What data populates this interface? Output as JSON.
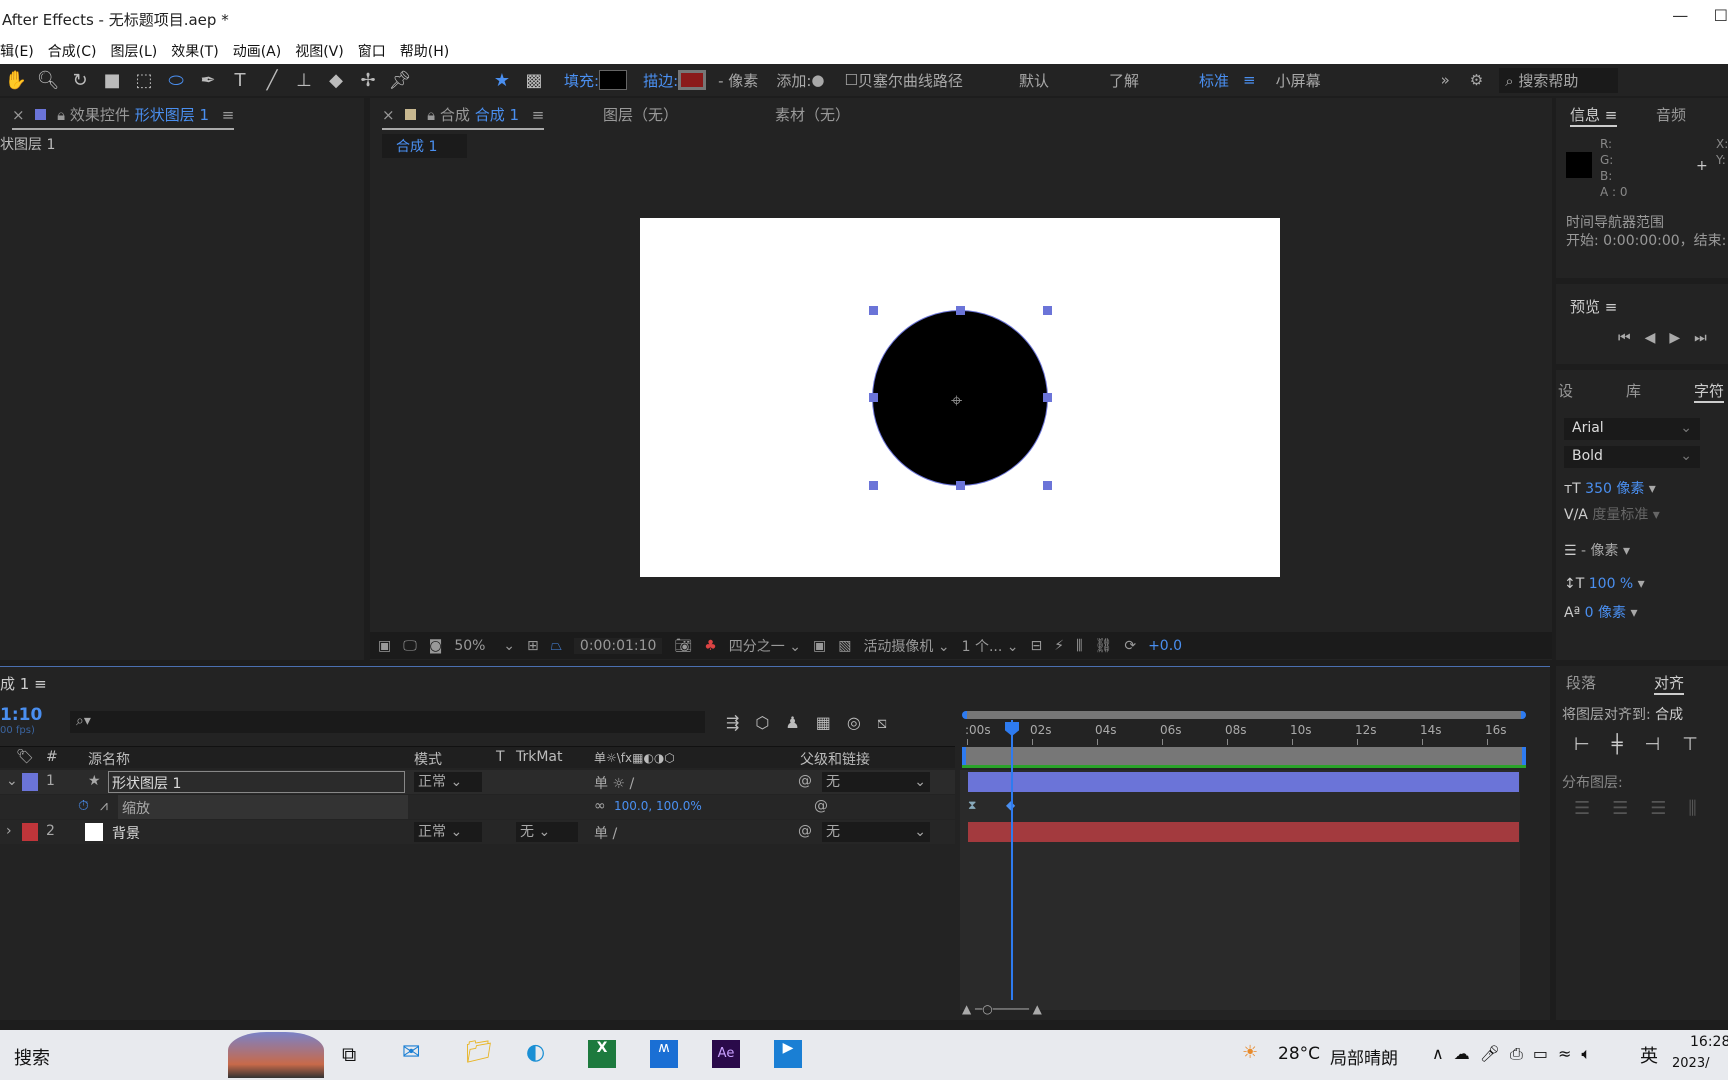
{
  "window": {
    "title": "After Effects - 无标题项目.aep *"
  },
  "menu": [
    "辑(E)",
    "合成(C)",
    "图层(L)",
    "效果(T)",
    "动画(A)",
    "视图(V)",
    "窗口",
    "帮助(H)"
  ],
  "toolbar": {
    "fill_label": "填充:",
    "stroke_label": "描边:",
    "stroke_px": "- 像素",
    "add_label": "添加:",
    "bezier_label": "贝塞尔曲线路径",
    "workspaces": [
      "默认",
      "了解",
      "标准",
      "小屏幕"
    ],
    "active_workspace": "标准",
    "search_help": "搜索帮助",
    "fill_color": "#000000",
    "stroke_color": "#8b1a1a"
  },
  "effects_panel": {
    "tab_prefix": "效果控件",
    "tab_layer": "形状图层 1",
    "layer_label": "状图层 1"
  },
  "comp_panel": {
    "tab_prefix": "合成",
    "tab_name": "合成 1",
    "layer_tab": "图层（无）",
    "footage_tab": "素材（无）",
    "sub_tab": "合成 1"
  },
  "viewer": {
    "zoom": "50%",
    "timecode": "0:00:01:10",
    "resolution": "四分之一",
    "camera": "活动摄像机",
    "views": "1 个...",
    "exposure": "+0.0",
    "canvas_color": "#ffffff",
    "shape_color": "#000000"
  },
  "info_panel": {
    "tab": "信息",
    "audio_tab": "音频",
    "r": "R:",
    "g": "G:",
    "b": "B:",
    "a": "A : 0",
    "x": "X:",
    "y": "Y:",
    "nav_title": "时间导航器范围",
    "nav_range": "开始: 0:00:00:00，结束:"
  },
  "preview_panel": {
    "tab": "预览"
  },
  "character_panel": {
    "tabs": [
      "设",
      "库",
      "字符"
    ],
    "font": "Arial",
    "style": "Bold",
    "size": "350 像素",
    "tracking_metric": "度量标准",
    "leading": "- 像素",
    "vscale": "100 %",
    "baseline": "0 像素"
  },
  "align_panel": {
    "tabs": [
      "段落",
      "对齐"
    ],
    "align_to_label": "将图层对齐到:",
    "align_to": "合成",
    "distribute_label": "分布图层:"
  },
  "timeline": {
    "tab": "成 1",
    "timecode": "1:10",
    "fps": "00 fps)",
    "columns": {
      "num": "#",
      "source": "源名称",
      "mode": "模式",
      "t": "T",
      "trkmat": "TrkMat",
      "switches": "单☼\\fx▦◐◑⬡",
      "parent": "父级和链接"
    },
    "layers": [
      {
        "num": "1",
        "name": "形状图层 1",
        "color": "#6b74d8",
        "mode": "正常",
        "trkmat": "",
        "parent": "无"
      },
      {
        "num": "2",
        "name": "背景",
        "color": "#c0353a",
        "mode": "正常",
        "trkmat": "无",
        "parent": "无"
      }
    ],
    "property": {
      "name": "缩放",
      "value": "100.0, 100.0%"
    },
    "ruler": [
      ":00s",
      "02s",
      "04s",
      "06s",
      "08s",
      "10s",
      "12s",
      "14s",
      "16s"
    ]
  },
  "taskbar": {
    "search": "搜索",
    "weather": "28°C",
    "weather_desc": "局部晴朗",
    "ime": "英",
    "time": "16:28",
    "date": "2023/"
  }
}
